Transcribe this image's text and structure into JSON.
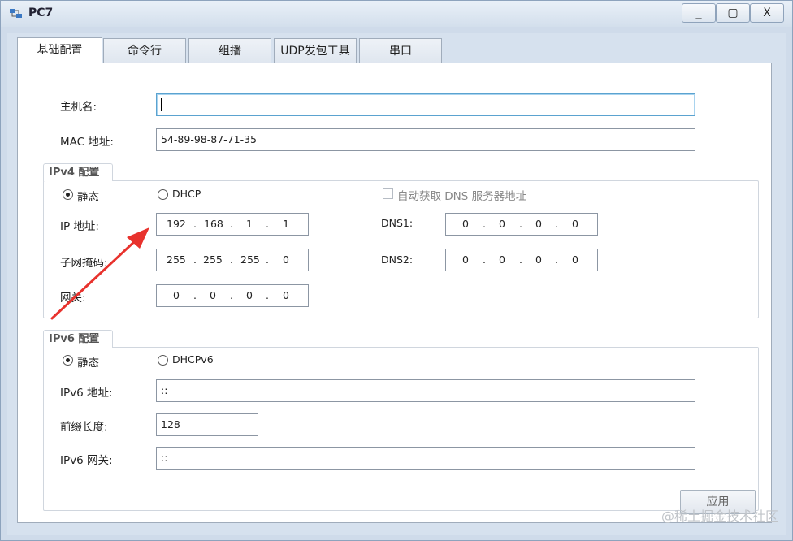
{
  "window": {
    "title": "PC7",
    "minimize": "_",
    "maximize": "▢",
    "close": "X"
  },
  "tabs": [
    "基础配置",
    "命令行",
    "组播",
    "UDP发包工具",
    "串口"
  ],
  "basic": {
    "hostname_label": "主机名:",
    "hostname_value": "",
    "mac_label": "MAC 地址:",
    "mac_value": "54-89-98-87-71-35"
  },
  "ipv4": {
    "group_title": "IPv4 配置",
    "static_label": "静态",
    "dhcp_label": "DHCP",
    "auto_dns_label": "自动获取 DNS 服务器地址",
    "ip_label": "IP 地址:",
    "ip_octets": [
      "192",
      "168",
      "1",
      "1"
    ],
    "mask_label": "子网掩码:",
    "mask_octets": [
      "255",
      "255",
      "255",
      "0"
    ],
    "gateway_label": "网关:",
    "gateway_octets": [
      "0",
      "0",
      "0",
      "0"
    ],
    "dns1_label": "DNS1:",
    "dns1_octets": [
      "0",
      "0",
      "0",
      "0"
    ],
    "dns2_label": "DNS2:",
    "dns2_octets": [
      "0",
      "0",
      "0",
      "0"
    ],
    "dot": "."
  },
  "ipv6": {
    "group_title": "IPv6 配置",
    "static_label": "静态",
    "dhcp_label": "DHCPv6",
    "address_label": "IPv6 地址:",
    "address_value": "::",
    "prefix_label": "前缀长度:",
    "prefix_value": "128",
    "gateway_label": "IPv6 网关:",
    "gateway_value": "::"
  },
  "apply_label": "应用",
  "watermark": "@稀土掘金技术社区",
  "colors": {
    "annotation_arrow": "#e8322d",
    "focus_border": "#5ba3d0"
  }
}
